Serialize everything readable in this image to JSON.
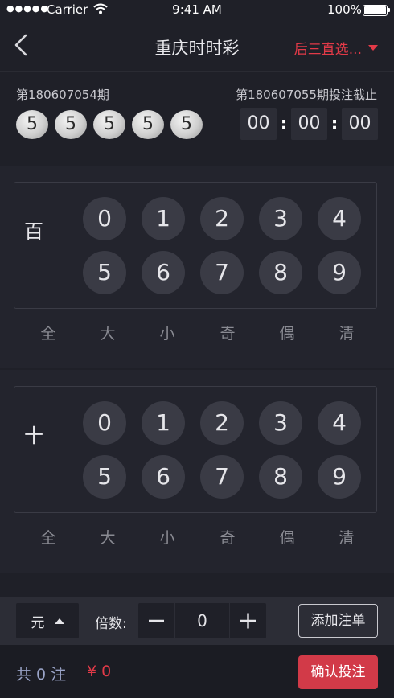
{
  "status_bar": {
    "carrier": "Carrier",
    "time": "9:41 AM",
    "battery": "100%"
  },
  "nav": {
    "title": "重庆时时彩",
    "mode": "后三直选..."
  },
  "draw": {
    "last_issue": "第180607054期",
    "last_result": [
      "5",
      "5",
      "5",
      "5",
      "5"
    ],
    "next_deadline": "第180607055期投注截止",
    "countdown": [
      "00",
      "00",
      "00"
    ]
  },
  "positions": [
    {
      "label": "百",
      "numbers": [
        "0",
        "1",
        "2",
        "3",
        "4",
        "5",
        "6",
        "7",
        "8",
        "9"
      ]
    },
    {
      "label": "十",
      "numbers": [
        "0",
        "1",
        "2",
        "3",
        "4",
        "5",
        "6",
        "7",
        "8",
        "9"
      ]
    }
  ],
  "quick_select": [
    "全",
    "大",
    "小",
    "奇",
    "偶",
    "清"
  ],
  "bet": {
    "unit": "元",
    "multiplier_label": "倍数:",
    "multiplier_value": "0",
    "add_to_slip": "添加注单"
  },
  "footer": {
    "count": "共 0 注",
    "amount": "¥ 0",
    "confirm": "确认投注"
  },
  "colors": {
    "accent": "#d23a48",
    "background": "#1f2028",
    "ball": "#3a3b45"
  }
}
